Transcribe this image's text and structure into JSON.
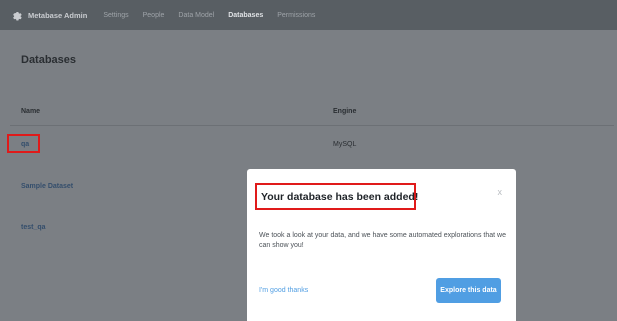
{
  "nav": {
    "brand": "Metabase Admin",
    "items": [
      {
        "label": "Settings",
        "active": false
      },
      {
        "label": "People",
        "active": false
      },
      {
        "label": "Data Model",
        "active": false
      },
      {
        "label": "Databases",
        "active": true
      },
      {
        "label": "Permissions",
        "active": false
      }
    ]
  },
  "page": {
    "title": "Databases",
    "columns": {
      "name": "Name",
      "engine": "Engine"
    },
    "rows": [
      {
        "name": "qa",
        "engine": "MySQL"
      },
      {
        "name": "Sample Dataset",
        "engine": ""
      },
      {
        "name": "test_qa",
        "engine": ""
      }
    ]
  },
  "modal": {
    "title": "Your database has been added!",
    "close": "x",
    "body": "We took a look at your data, and we have some automated explorations that we can show you!",
    "dismiss": "I'm good thanks",
    "primary": "Explore this data"
  },
  "colors": {
    "accent": "#509ee3",
    "highlight": "#e01a1a",
    "nav_bg": "#585e63"
  }
}
